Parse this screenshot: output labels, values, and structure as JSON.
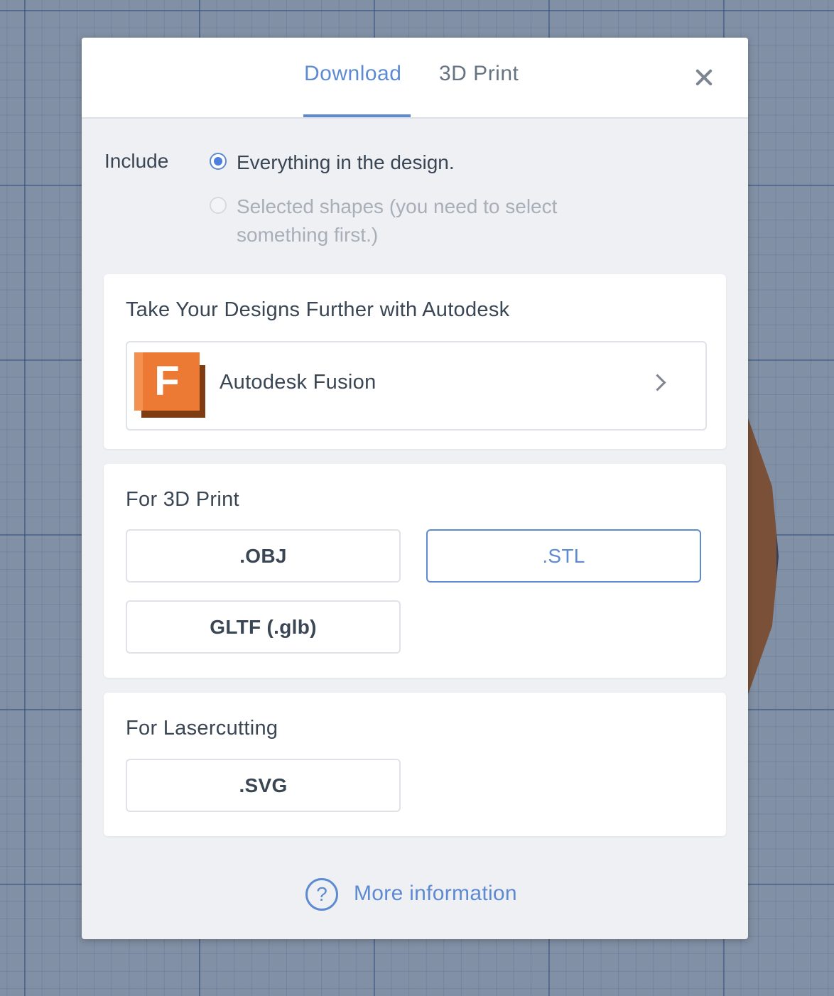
{
  "dialog": {
    "tabs": [
      {
        "label": "Download",
        "active": true
      },
      {
        "label": "3D Print",
        "active": false
      }
    ],
    "close_icon": "close-icon"
  },
  "include": {
    "label": "Include",
    "options": [
      {
        "label": "Everything in the design.",
        "checked": true,
        "disabled": false
      },
      {
        "label": "Selected shapes (you need to select something first.)",
        "checked": false,
        "disabled": true
      }
    ]
  },
  "autodesk": {
    "title": "Take Your Designs Further with Autodesk",
    "fusion_label": "Autodesk Fusion",
    "logo_letter": "F"
  },
  "print3d": {
    "title": "For 3D Print",
    "formats": [
      ".OBJ",
      ".STL",
      "GLTF (.glb)"
    ],
    "selected": ".STL"
  },
  "laser": {
    "title": "For Lasercutting",
    "formats": [
      ".SVG"
    ]
  },
  "help": {
    "icon_glyph": "?",
    "label": "More information"
  },
  "colors": {
    "accent": "#5d8ad1",
    "radio_fill": "#4d7fe0",
    "fusion_orange": "#ec7a34",
    "fusion_dark": "#7f3c12"
  }
}
